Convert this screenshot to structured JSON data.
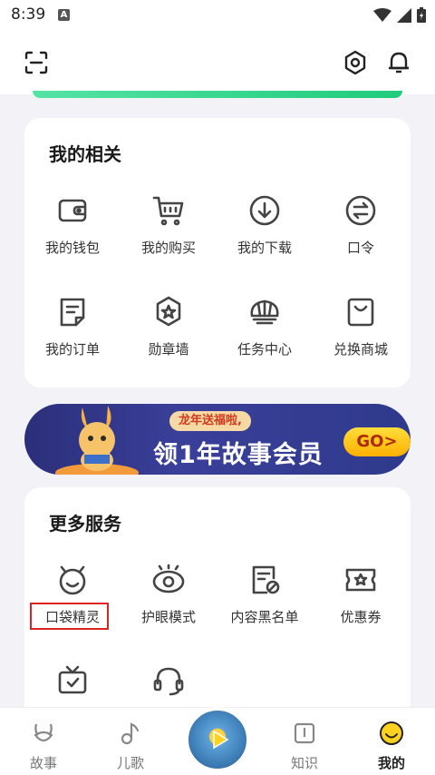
{
  "status": {
    "time": "8:39",
    "notification": "A"
  },
  "my_section": {
    "title": "我的相关",
    "items": [
      {
        "label": "我的钱包",
        "icon": "wallet-icon"
      },
      {
        "label": "我的购买",
        "icon": "cart-icon"
      },
      {
        "label": "我的下载",
        "icon": "download-icon"
      },
      {
        "label": "口令",
        "icon": "exchange-icon"
      },
      {
        "label": "我的订单",
        "icon": "order-icon"
      },
      {
        "label": "勋章墙",
        "icon": "medal-icon"
      },
      {
        "label": "任务中心",
        "icon": "shell-icon"
      },
      {
        "label": "兑换商城",
        "icon": "shopping-bag-icon"
      }
    ]
  },
  "banner": {
    "tag": "龙年送福啦,",
    "headline": "领1年故事会员",
    "button": "GO>"
  },
  "more_section": {
    "title": "更多服务",
    "items": [
      {
        "label": "口袋精灵",
        "icon": "smiley-robot-icon"
      },
      {
        "label": "护眼模式",
        "icon": "eye-icon"
      },
      {
        "label": "内容黑名单",
        "icon": "block-list-icon"
      },
      {
        "label": "优惠券",
        "icon": "coupon-icon"
      },
      {
        "label": "",
        "icon": "tv-icon"
      },
      {
        "label": "",
        "icon": "headset-icon"
      }
    ]
  },
  "tabbar": {
    "tabs": [
      {
        "label": "故事",
        "icon": "rabbit-icon"
      },
      {
        "label": "儿歌",
        "icon": "music-note-icon"
      },
      {
        "label": "知识",
        "icon": "book-icon"
      },
      {
        "label": "我的",
        "icon": "smiley-icon",
        "active": true
      }
    ]
  }
}
